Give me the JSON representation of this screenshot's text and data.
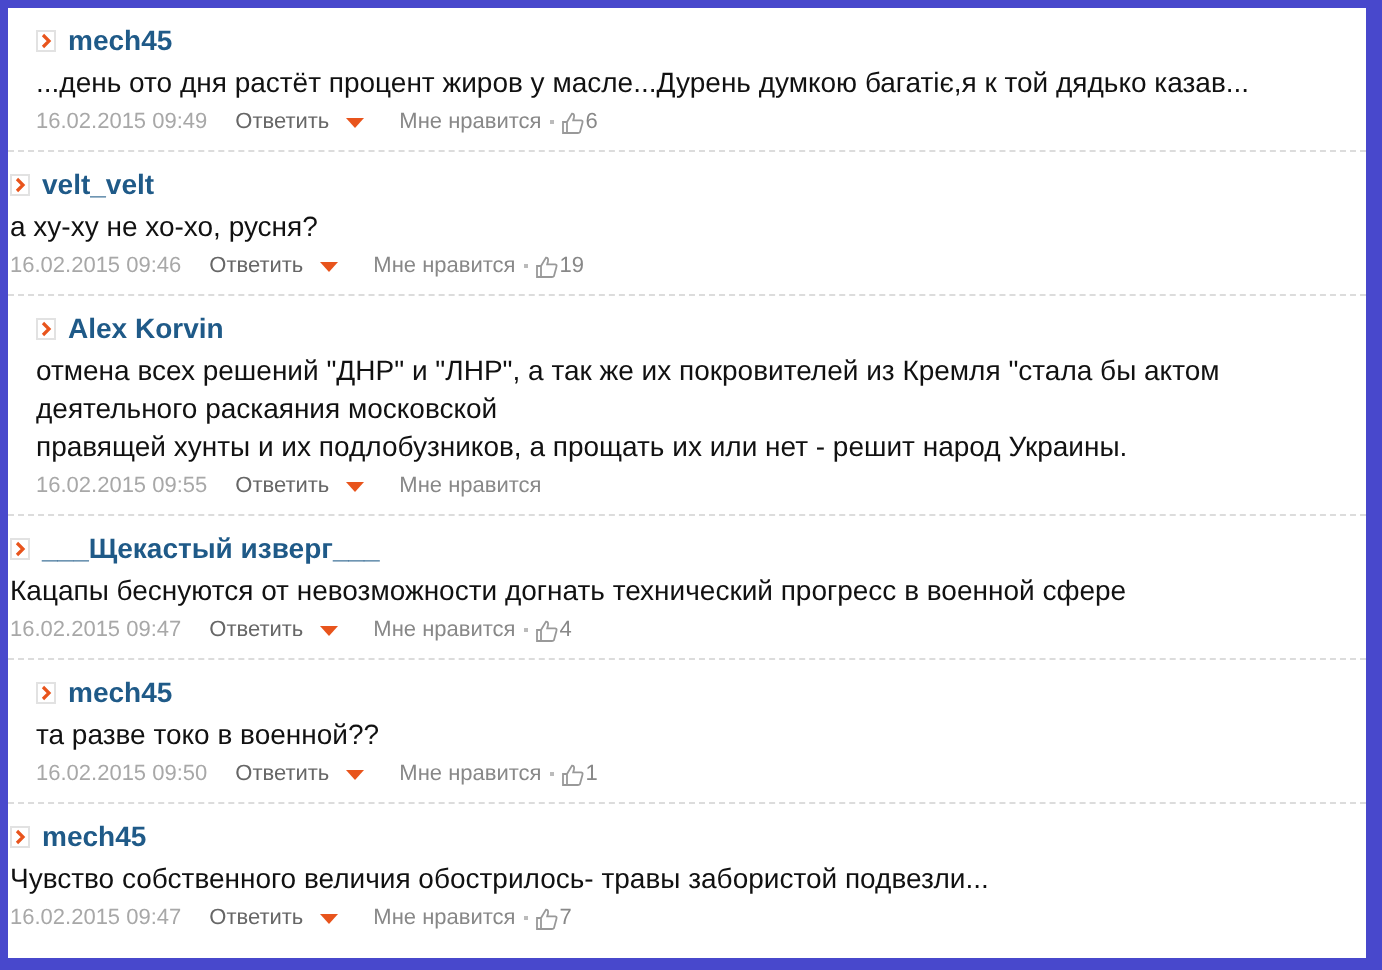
{
  "comments": [
    {
      "kind": "reply",
      "author": "mech45",
      "paragraphs": [
        "...день ото дня растёт процент жиров у масле...Дурень думкою багатiє,я к той дядько казав..."
      ],
      "date": "16.02.2015 09:49",
      "reply_label": "Ответить",
      "like_label": "Мне нравится",
      "likes": "6"
    },
    {
      "kind": "comment",
      "author": "velt_velt",
      "paragraphs": [
        "а ху-ху не хо-хо, русня?"
      ],
      "date": "16.02.2015 09:46",
      "reply_label": "Ответить",
      "like_label": "Мне нравится",
      "likes": "19"
    },
    {
      "kind": "reply",
      "author": "Alex Korvin",
      "paragraphs": [
        "отмена всех решений \"ДНР\" и \"ЛНР\", а так же их покровителей из Кремля \"стала бы актом деятельного раскаяния московской",
        "правящей хунты и их подлобузников, а прощать их или нет - решит народ Украины."
      ],
      "date": "16.02.2015 09:55",
      "reply_label": "Ответить",
      "like_label": "Мне нравится"
    },
    {
      "kind": "comment",
      "author": "___Щекастый изверг___",
      "paragraphs": [
        "Кацапы беснуются от невозможности догнать технический прогресс в военной сфере"
      ],
      "date": "16.02.2015 09:47",
      "reply_label": "Ответить",
      "like_label": "Мне нравится",
      "likes": "4"
    },
    {
      "kind": "reply",
      "author": "mech45",
      "paragraphs": [
        "та разве токо в военной??"
      ],
      "date": "16.02.2015 09:50",
      "reply_label": "Ответить",
      "like_label": "Мне нравится",
      "likes": "1"
    },
    {
      "kind": "comment",
      "author": "mech45",
      "paragraphs": [
        "Чувство собственного величия обострилось- травы забористой подвезли..."
      ],
      "date": "16.02.2015 09:47",
      "reply_label": "Ответить",
      "like_label": "Мне нравится",
      "likes": "7"
    }
  ]
}
